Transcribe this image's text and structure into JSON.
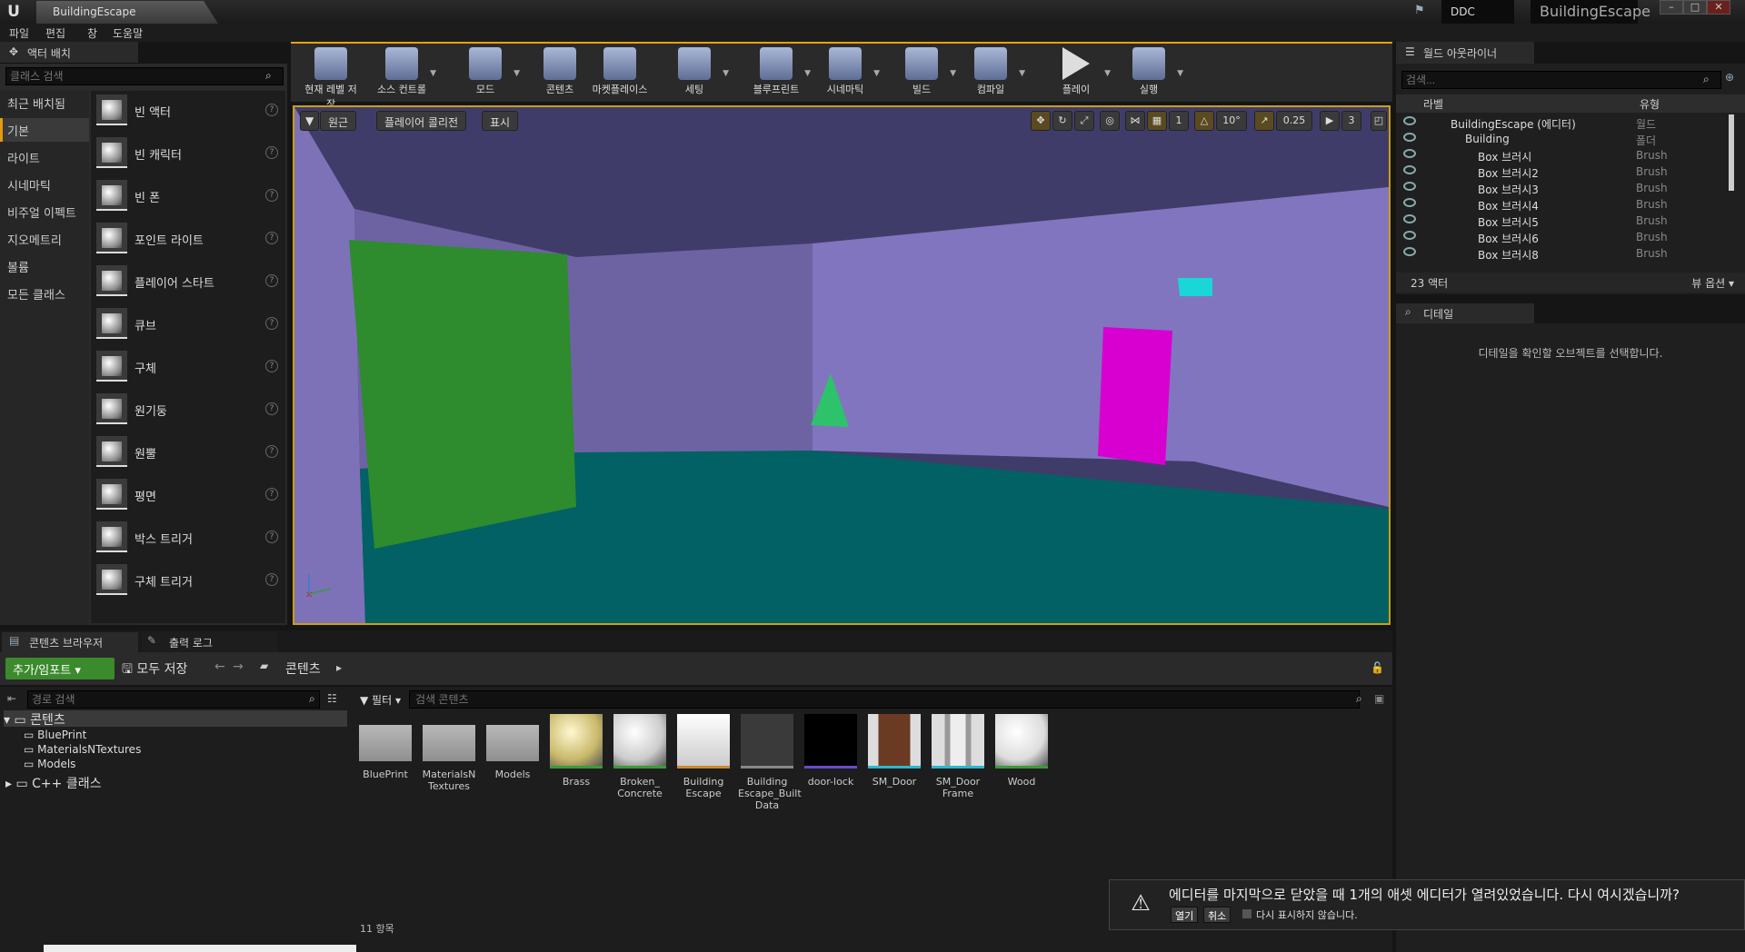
{
  "window": {
    "doc_tab": "BuildingEscape",
    "ddc": "DDC",
    "project": "BuildingEscape"
  },
  "menu": [
    "파일",
    "편집",
    "창",
    "도움말"
  ],
  "place_actors": {
    "tab": "액터 배치",
    "search_placeholder": "클래스 검색",
    "categories": [
      "최근 배치됨",
      "기본",
      "라이트",
      "시네마틱",
      "비주얼 이펙트",
      "지오메트리",
      "볼륨",
      "모든 클래스"
    ],
    "selected_category": "기본",
    "items": [
      "빈 액터",
      "빈 캐릭터",
      "빈 폰",
      "포인트 라이트",
      "플레이어 스타트",
      "큐브",
      "구체",
      "원기둥",
      "원뿔",
      "평면",
      "박스 트리거",
      "구체 트리거"
    ]
  },
  "toolbar": [
    {
      "label": "현재 레벨 저장",
      "icon": "save-icon"
    },
    {
      "label": "소스 컨트롤",
      "icon": "source-control-icon"
    },
    {
      "label": "모드",
      "icon": "modes-icon"
    },
    {
      "label": "콘텐츠",
      "icon": "content-icon"
    },
    {
      "label": "마켓플레이스",
      "icon": "marketplace-icon"
    },
    {
      "label": "세팅",
      "icon": "settings-icon"
    },
    {
      "label": "블루프린트",
      "icon": "blueprints-icon"
    },
    {
      "label": "시네마틱",
      "icon": "cinematics-icon"
    },
    {
      "label": "빌드",
      "icon": "build-icon"
    },
    {
      "label": "컴파일",
      "icon": "compile-icon"
    },
    {
      "label": "플레이",
      "icon": "play-icon"
    },
    {
      "label": "실행",
      "icon": "launch-icon"
    }
  ],
  "viewport": {
    "buttons": [
      "원근",
      "플레이어 콜리전",
      "표시"
    ],
    "rotation_snap": "10°",
    "scale_snap": "0.25",
    "camera_speed": "3",
    "grid_snap": "1",
    "colors": {
      "ceiling": "#403c6a",
      "left_wall": "#7d72b8",
      "back_wall": "#6d63a3",
      "right_wall": "#8175c0",
      "floor": "#016164",
      "green_panel": "#2e8b2e",
      "magenta_door": "#d800d0",
      "cone": "#2ec26a",
      "cyan_block": "#1ad7d7"
    }
  },
  "outliner": {
    "tab": "월드 아웃라이너",
    "search_placeholder": "검색...",
    "col_label": "라벨",
    "col_type": "유형",
    "rows": [
      {
        "name": "BuildingEscape (에디터)",
        "type": "월드"
      },
      {
        "name": "Building",
        "type": "폴더"
      },
      {
        "name": "Box 브러시",
        "type": "Brush"
      },
      {
        "name": "Box 브러시2",
        "type": "Brush"
      },
      {
        "name": "Box 브러시3",
        "type": "Brush"
      },
      {
        "name": "Box 브러시4",
        "type": "Brush"
      },
      {
        "name": "Box 브러시5",
        "type": "Brush"
      },
      {
        "name": "Box 브러시6",
        "type": "Brush"
      },
      {
        "name": "Box 브러시8",
        "type": "Brush"
      }
    ],
    "count": "23 액터",
    "view_options": "뷰 옵션"
  },
  "details": {
    "tab": "디테일",
    "message": "디테일을 확인할 오브젝트를 선택합니다."
  },
  "content_browser": {
    "tabs": [
      "콘텐츠 브라우저",
      "출력 로그"
    ],
    "add_import": "추가/임포트",
    "save_all": "모두 저장",
    "path": "콘텐츠",
    "path_search_placeholder": "경로 검색",
    "tree": [
      "콘텐츠",
      "BluePrint",
      "MaterialsNTextures",
      "Models",
      "C++ 클래스"
    ],
    "filters": "필터",
    "asset_search_placeholder": "검색 콘텐츠",
    "assets": [
      {
        "name": "BluePrint",
        "kind": "folder"
      },
      {
        "name": "MaterialsN\nTextures",
        "kind": "folder"
      },
      {
        "name": "Models",
        "kind": "folder"
      },
      {
        "name": "Brass",
        "kind": "material",
        "color": "#e8dca0"
      },
      {
        "name": "Broken_\nConcrete",
        "kind": "material",
        "color": "#e8e8e8"
      },
      {
        "name": "Building\nEscape",
        "kind": "level",
        "color": "#c98a2f"
      },
      {
        "name": "Building\nEscape_Built\nData",
        "kind": "data",
        "color": "#444"
      },
      {
        "name": "door-lock",
        "kind": "texture",
        "color": "#000"
      },
      {
        "name": "SM_Door",
        "kind": "mesh",
        "color": "#6b3a22"
      },
      {
        "name": "SM_Door\nFrame",
        "kind": "mesh",
        "color": "#bbbbbb"
      },
      {
        "name": "Wood",
        "kind": "material",
        "color": "#f0f0f0"
      }
    ],
    "item_count": "11 항목"
  },
  "dialog": {
    "message": "에디터를 마지막으로 닫았을 때 1개의 애셋 에디터가 열려있었습니다. 다시 여시겠습니까?",
    "open": "열기",
    "cancel": "취소",
    "dont_show": "다시 표시하지 않습니다."
  }
}
